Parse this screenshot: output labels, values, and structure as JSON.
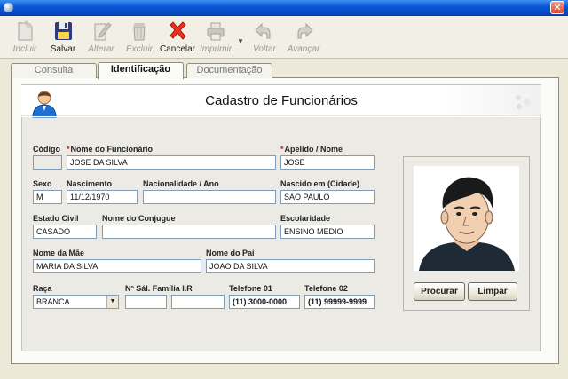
{
  "window": {
    "close_glyph": "✕"
  },
  "toolbar": {
    "buttons": [
      {
        "label": "Incluir",
        "icon": "document-add-icon",
        "enabled": false
      },
      {
        "label": "Salvar",
        "icon": "floppy-disk-icon",
        "enabled": true
      },
      {
        "label": "Alterar",
        "icon": "document-edit-icon",
        "enabled": false
      },
      {
        "label": "Excluir",
        "icon": "trash-bin-icon",
        "enabled": false
      },
      {
        "label": "Cancelar",
        "icon": "red-x-icon",
        "enabled": true
      },
      {
        "label": "Imprimir",
        "icon": "printer-icon",
        "enabled": false
      },
      {
        "label": "Voltar",
        "icon": "back-arrow-icon",
        "enabled": false
      },
      {
        "label": "Avançar",
        "icon": "forward-arrow-icon",
        "enabled": false
      }
    ],
    "print_dropdown_glyph": "▼"
  },
  "tabs": [
    {
      "label": "Consulta",
      "active": false
    },
    {
      "label": "Identificação",
      "active": true
    },
    {
      "label": "Documentação",
      "active": false
    }
  ],
  "form": {
    "title": "Cadastro de Funcionários",
    "required_mark": "*",
    "fields": {
      "codigo": {
        "label": "Código",
        "value": ""
      },
      "nome": {
        "label": "Nome do Funcionário",
        "value": "JOSE DA SILVA"
      },
      "apelido": {
        "label": "Apelido / Nome",
        "value": "JOSE"
      },
      "sexo": {
        "label": "Sexo",
        "value": "M"
      },
      "nascimento": {
        "label": "Nascimento",
        "value": "11/12/1970"
      },
      "nacionalidade": {
        "label": "Nacionalidade / Ano",
        "value": ""
      },
      "nascido_em": {
        "label": "Nascido em (Cidade)",
        "value": "SAO PAULO"
      },
      "estado_civil": {
        "label": "Estado Civil",
        "value": "CASADO"
      },
      "conjuge": {
        "label": "Nome do Conjugue",
        "value": ""
      },
      "escolaridade": {
        "label": "Escolaridade",
        "value": "ENSINO MEDIO"
      },
      "mae": {
        "label": "Nome da Mãe",
        "value": "MARIA DA SILVA"
      },
      "pai": {
        "label": "Nome do Pai",
        "value": "JOAO DA SILVA"
      },
      "raca": {
        "label": "Raça",
        "value": "BRANCA"
      },
      "sal_familia": {
        "label": "Nº Sál. Família  I.R",
        "value_1": "",
        "value_2": ""
      },
      "telefone1": {
        "label": "Telefone 01",
        "value": "(11) 3000-0000"
      },
      "telefone2": {
        "label": "Telefone 02",
        "value": "(11) 99999-9999"
      }
    },
    "select_arrow": "▼"
  },
  "photo_panel": {
    "buttons": {
      "procurar": "Procurar",
      "limpar": "Limpar"
    }
  },
  "colors": {
    "titlebar": "#0a55d8",
    "required": "#d0161a",
    "cancel_icon": "#e8321e",
    "field_border": "#7f9db9"
  }
}
